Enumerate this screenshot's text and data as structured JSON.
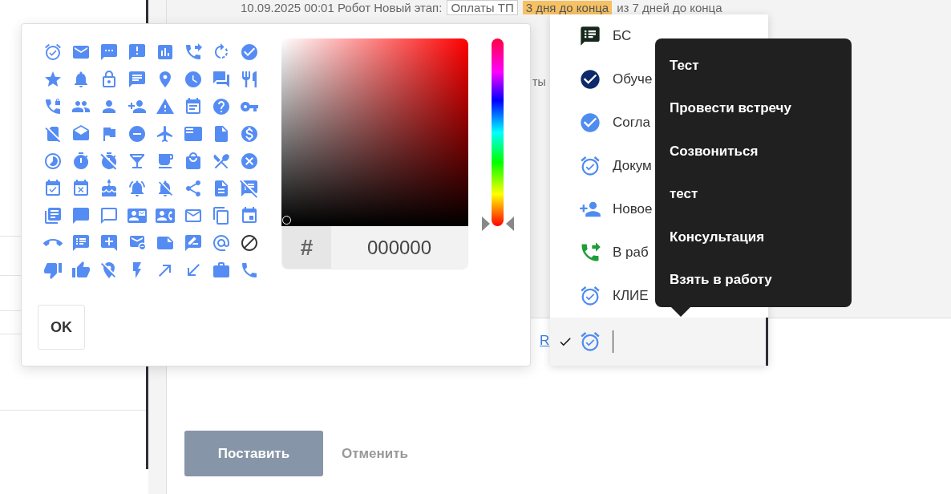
{
  "header": {
    "event": "10.09.2025 00:01 Робот Новый этап:",
    "stage": "Оплаты ТП",
    "deadline": "3 дня до конца",
    "limit": "из 7 дней до конца"
  },
  "fragments": {
    "label": "ты",
    "link": "R"
  },
  "icon_picker": {
    "hex_prefix": "#",
    "hex_value": "000000",
    "hue": {
      "level": 0
    },
    "ok_button": "OK"
  },
  "dropdown": {
    "items": [
      {
        "label": "БС",
        "selected": false
      },
      {
        "label": "Обуче",
        "selected": false
      },
      {
        "label": "Согла",
        "selected": false
      },
      {
        "label": "Докум",
        "selected": false
      },
      {
        "label": "Новое",
        "selected": false
      },
      {
        "label": "В раб",
        "selected": false
      },
      {
        "label": "КЛИЕ",
        "selected": false
      },
      {
        "selected": true
      }
    ]
  },
  "tooltip": {
    "items": [
      "Тест",
      "Провести встречу",
      "Созвониться",
      "тест",
      "Консультация",
      "Взять в работу"
    ]
  },
  "actions": {
    "submit": "Поставить",
    "cancel": "Отменить"
  }
}
